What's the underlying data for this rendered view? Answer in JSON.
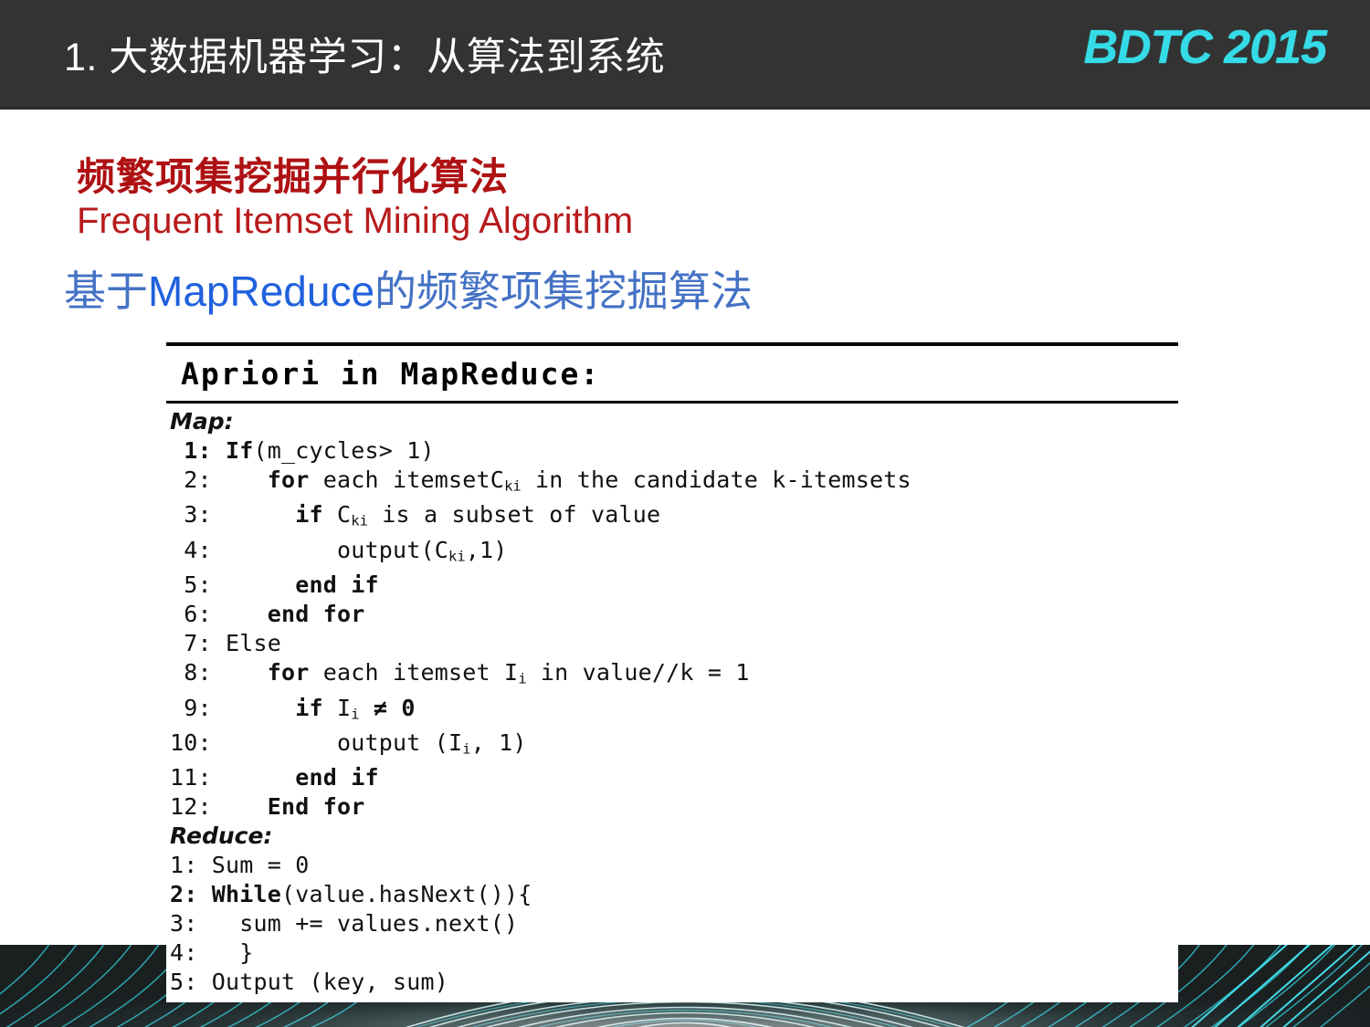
{
  "header": {
    "title": "1. 大数据机器学习：从算法到系统",
    "brand": "BDTC 2015",
    "bar_color": "#333333",
    "brand_color": "#35DCE8"
  },
  "content": {
    "heading_cn": "频繁项集挖掘并行化算法",
    "heading_en": "Frequent Itemset Mining Algorithm",
    "heading_color": "#AE1113",
    "subheading": {
      "prefix": "基于",
      "highlight": "MapReduce",
      "suffix": "的频繁项集挖掘算法",
      "color": "#4472C4",
      "highlight_color": "#2061DD"
    }
  },
  "code_block": {
    "title": "Apriori in MapReduce:",
    "map_label": "Map:",
    "reduce_label": "Reduce:",
    "map_lines": [
      " 1: If(m_cycles> 1)",
      " 2:    for each itemsetCki in the candidate k-itemsets",
      " 3:      if Cki is a subset of value",
      " 4:        output(Cki,1)",
      " 5:      end if",
      " 6:    end for",
      " 7: Else",
      " 8:    for each itemset Ii in value//k = 1",
      " 9:      if Ii ≠ 0",
      "10:        output (Ii, 1)",
      "11:      end if",
      "12:    End for"
    ],
    "reduce_lines": [
      "1: Sum = 0",
      "2: While(value.hasNext()){",
      "3:   sum += values.next()",
      "4:   }",
      "5: Output (key, sum)"
    ]
  },
  "decoration": {
    "band_color": "#1a1f20",
    "wave_color_a": "#2FBFC9",
    "wave_color_b": "#D9F2F2"
  }
}
